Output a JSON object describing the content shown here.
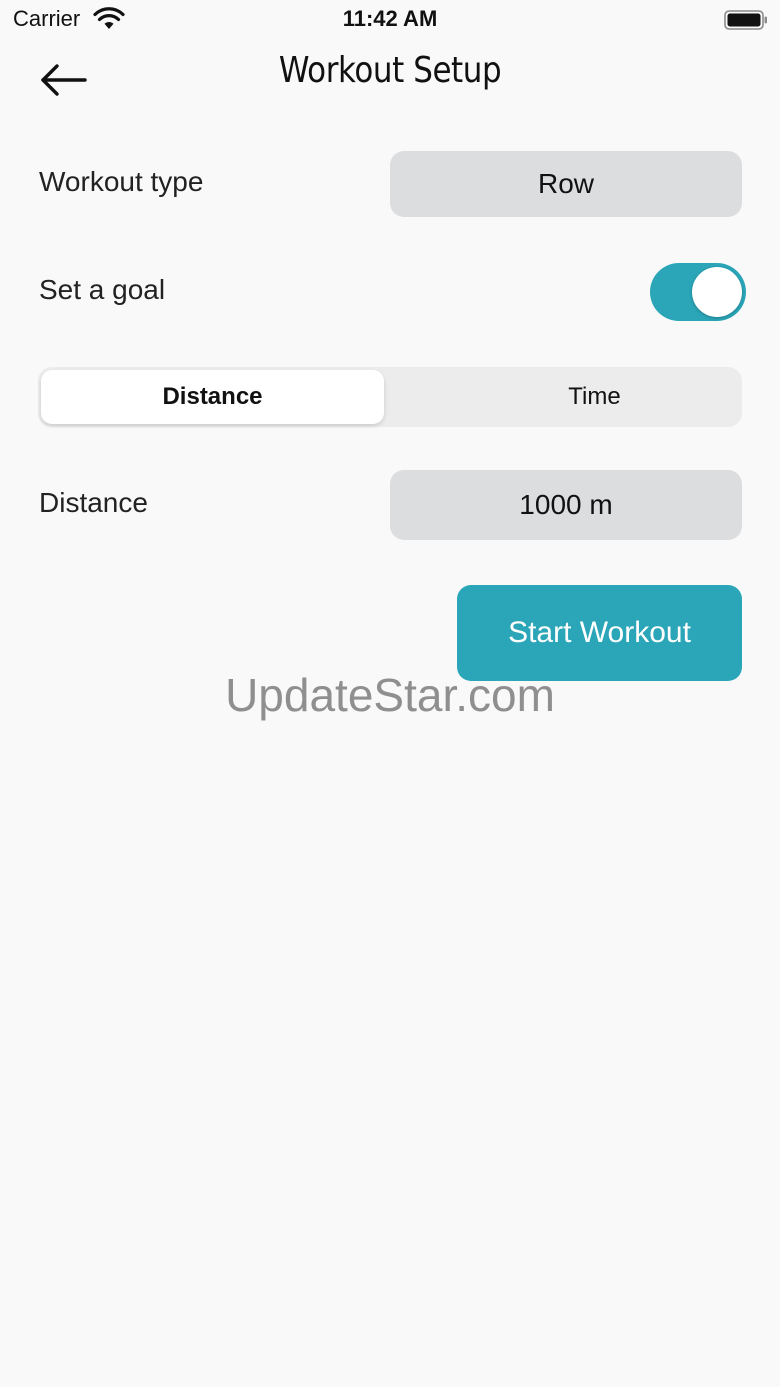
{
  "status_bar": {
    "carrier": "Carrier",
    "time": "11:42 AM",
    "wifi_icon": "wifi-icon",
    "battery_icon": "battery-icon"
  },
  "header": {
    "back_icon": "arrow-left-icon",
    "title": "Workout Setup"
  },
  "workout_type": {
    "label": "Workout type",
    "value": "Row"
  },
  "goal": {
    "label": "Set a goal",
    "enabled": true
  },
  "goal_mode": {
    "options": [
      "Distance",
      "Time"
    ],
    "selected": "Distance"
  },
  "distance": {
    "label": "Distance",
    "value": "1000 m"
  },
  "start_button": {
    "label": "Start Workout"
  },
  "watermark": "UpdateStar.com",
  "colors": {
    "accent": "#2aa6b8",
    "background": "#f9f9f9",
    "pill": "#dcdddf"
  }
}
